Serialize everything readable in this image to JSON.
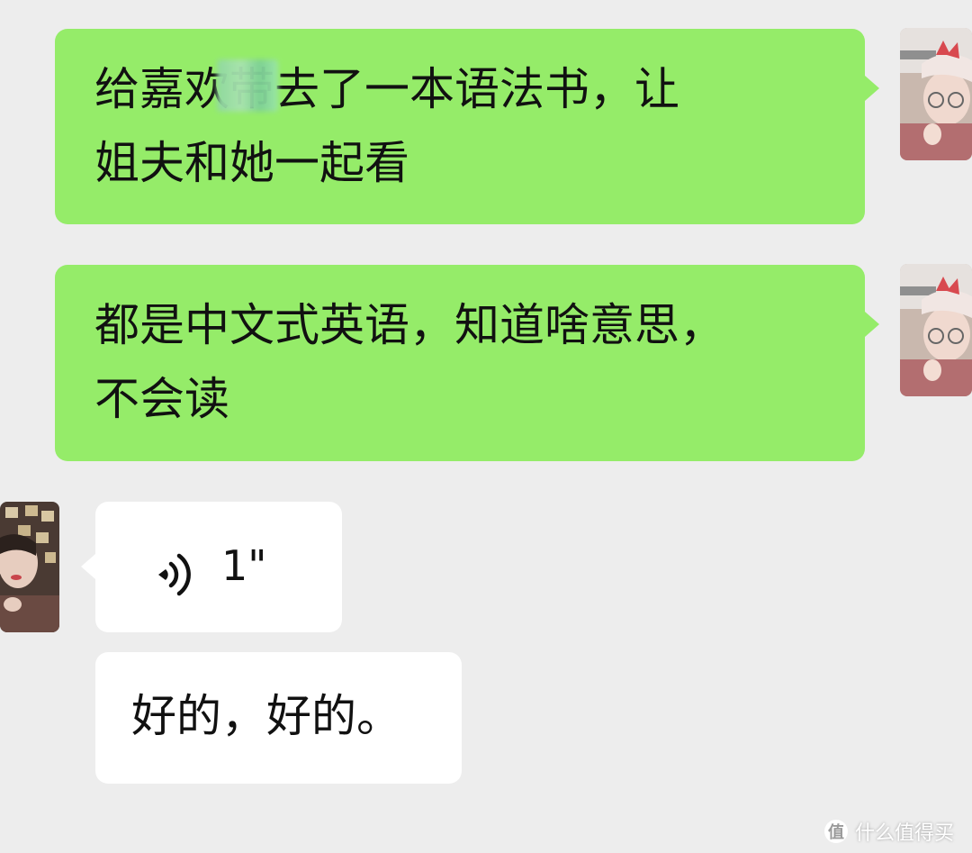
{
  "messages": [
    {
      "side": "right",
      "type": "text",
      "lines": [
        "给嘉欢带去了一本语法书，让",
        "姐夫和她一起看"
      ]
    },
    {
      "side": "right",
      "type": "text",
      "lines": [
        "都是中文式英语，知道啥意思，",
        "不会读"
      ]
    },
    {
      "side": "left",
      "type": "voice",
      "duration": "1\""
    },
    {
      "side": "left",
      "type": "text",
      "lines": [
        "好的，好的。"
      ]
    }
  ],
  "watermark": {
    "logo": "值",
    "text": "什么值得买"
  },
  "colors": {
    "background": "#ededed",
    "sent_bubble": "#95ec69",
    "received_bubble": "#ffffff"
  },
  "icons": {
    "voice": "voice-wave-icon"
  }
}
